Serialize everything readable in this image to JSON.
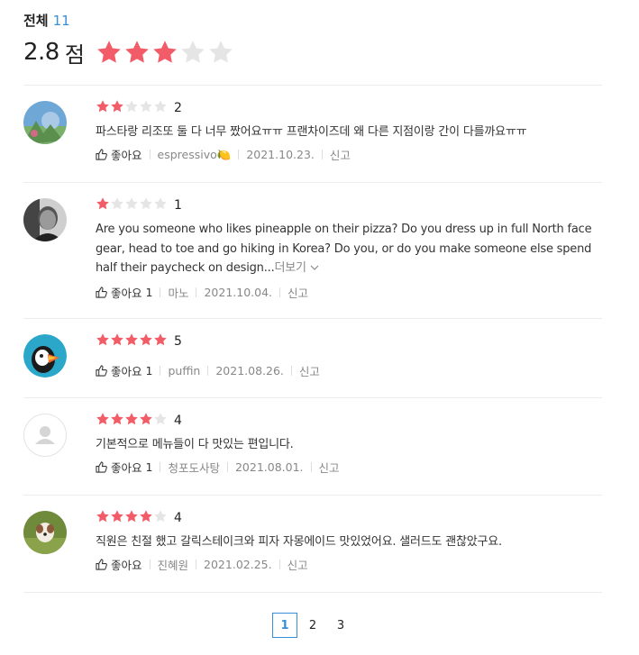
{
  "header": {
    "total_label": "전체",
    "total_count": "11",
    "score": "2.8",
    "score_unit": "점",
    "score_stars_filled": 3,
    "score_stars_max": 5
  },
  "colors": {
    "star_on": "#f25c68",
    "star_off": "#e5e5e5",
    "accent": "#3a8fd9"
  },
  "reviews": [
    {
      "stars": 2,
      "rating": "2",
      "text": "파스타랑 리조또 둘 다 너무 짰어요ㅠㅠ 프랜차이즈데 왜 다른 지점이랑 간이 다를까요ㅠㅠ",
      "like": "좋아요",
      "like_count": "",
      "author": "espressivo🍋",
      "date": "2021.10.23.",
      "report": "신고",
      "avatar": "landscape-photo"
    },
    {
      "stars": 1,
      "rating": "1",
      "text": "Are you someone who likes pineapple on their pizza? Do you dress up in full North face gear, head to toe and go hiking in Korea? Do you, or do you make someone else spend half their paycheck on design...",
      "more": "더보기",
      "like": "좋아요",
      "like_count": "1",
      "author": "마노",
      "date": "2021.10.04.",
      "report": "신고",
      "avatar": "person-photo"
    },
    {
      "stars": 5,
      "rating": "5",
      "text": "",
      "like": "좋아요",
      "like_count": "1",
      "author": "puffin",
      "date": "2021.08.26.",
      "report": "신고",
      "avatar": "puffin-logo"
    },
    {
      "stars": 4,
      "rating": "4",
      "text": "기본적으로 메뉴들이 다 맛있는 편입니다.",
      "like": "좋아요",
      "like_count": "1",
      "author": "청포도사탕",
      "date": "2021.08.01.",
      "report": "신고",
      "avatar": "default-avatar"
    },
    {
      "stars": 4,
      "rating": "4",
      "text": "직원은 친절 했고 갈릭스테이크와 피자 자몽에이드 맛있었어요. 샐러드도 괜찮았구요.",
      "like": "좋아요",
      "like_count": "",
      "author": "진혜원",
      "date": "2021.02.25.",
      "report": "신고",
      "avatar": "dog-photo"
    }
  ],
  "pagination": {
    "pages": [
      "1",
      "2",
      "3"
    ],
    "current": "1"
  }
}
